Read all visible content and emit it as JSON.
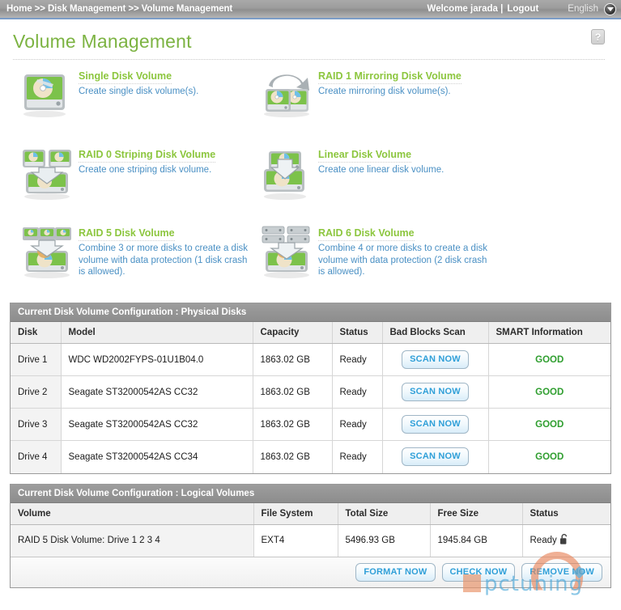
{
  "topbar": {
    "breadcrumb": "Home >> Disk Management >> Volume Management",
    "welcome": "Welcome jarada  |",
    "logout": "Logout",
    "language": "English",
    "lang_caret_icon": "chevron-down-icon"
  },
  "page": {
    "title": "Volume Management",
    "help_label": "?"
  },
  "volume_types": [
    {
      "icon": "single-disk-icon",
      "title": "Single Disk Volume",
      "desc": "Create single disk volume(s)."
    },
    {
      "icon": "raid1-mirror-disk-icon",
      "title": "RAID 1 Mirroring Disk Volume",
      "desc": "Create mirroring disk volume(s)."
    },
    {
      "icon": "raid0-striping-disk-icon",
      "title": "RAID 0 Striping Disk Volume",
      "desc": "Create one striping disk volume."
    },
    {
      "icon": "linear-disk-icon",
      "title": "Linear Disk Volume",
      "desc": "Create one linear disk volume."
    },
    {
      "icon": "raid5-disk-icon",
      "title": "RAID 5 Disk Volume",
      "desc": "Combine 3 or more disks to create a disk volume with data protection (1 disk crash is allowed)."
    },
    {
      "icon": "raid6-disk-icon",
      "title": "RAID 6 Disk Volume",
      "desc": "Combine 4 or more disks to create a disk volume with data protection (2 disk crash is allowed)."
    }
  ],
  "physical_disks": {
    "panel_title": "Current Disk Volume Configuration : Physical Disks",
    "columns": [
      "Disk",
      "Model",
      "Capacity",
      "Status",
      "Bad Blocks Scan",
      "SMART Information"
    ],
    "rows": [
      {
        "disk": "Drive 1",
        "model": "WDC WD2002FYPS-01U1B04.0",
        "capacity": "1863.02 GB",
        "status": "Ready",
        "scan_label": "SCAN NOW",
        "smart": "GOOD"
      },
      {
        "disk": "Drive 2",
        "model": "Seagate ST32000542AS CC32",
        "capacity": "1863.02 GB",
        "status": "Ready",
        "scan_label": "SCAN NOW",
        "smart": "GOOD"
      },
      {
        "disk": "Drive 3",
        "model": "Seagate ST32000542AS CC32",
        "capacity": "1863.02 GB",
        "status": "Ready",
        "scan_label": "SCAN NOW",
        "smart": "GOOD"
      },
      {
        "disk": "Drive 4",
        "model": "Seagate ST32000542AS CC34",
        "capacity": "1863.02 GB",
        "status": "Ready",
        "scan_label": "SCAN NOW",
        "smart": "GOOD"
      }
    ]
  },
  "logical_volumes": {
    "panel_title": "Current Disk Volume Configuration : Logical Volumes",
    "columns": [
      "Volume",
      "File System",
      "Total Size",
      "Free Size",
      "Status"
    ],
    "rows": [
      {
        "volume": "RAID 5 Disk Volume: Drive 1 2 3 4",
        "file_system": "EXT4",
        "total_size": "5496.93 GB",
        "free_size": "1945.84 GB",
        "status": "Ready",
        "status_icon": "unlocked-padlock-icon"
      }
    ],
    "actions": [
      {
        "label": "FORMAT NOW",
        "name": "format-now-button"
      },
      {
        "label": "CHECK NOW",
        "name": "check-now-button"
      },
      {
        "label": "REMOVE NOW",
        "name": "remove-now-button"
      }
    ]
  },
  "watermark": {
    "text": "pctuning"
  },
  "colors": {
    "accent_green": "#8cc63e",
    "link_blue": "#4a90c4",
    "button_blue": "#2f9fd8",
    "smart_good": "#2f9e2f",
    "header_grey": "#9d9d9d"
  }
}
